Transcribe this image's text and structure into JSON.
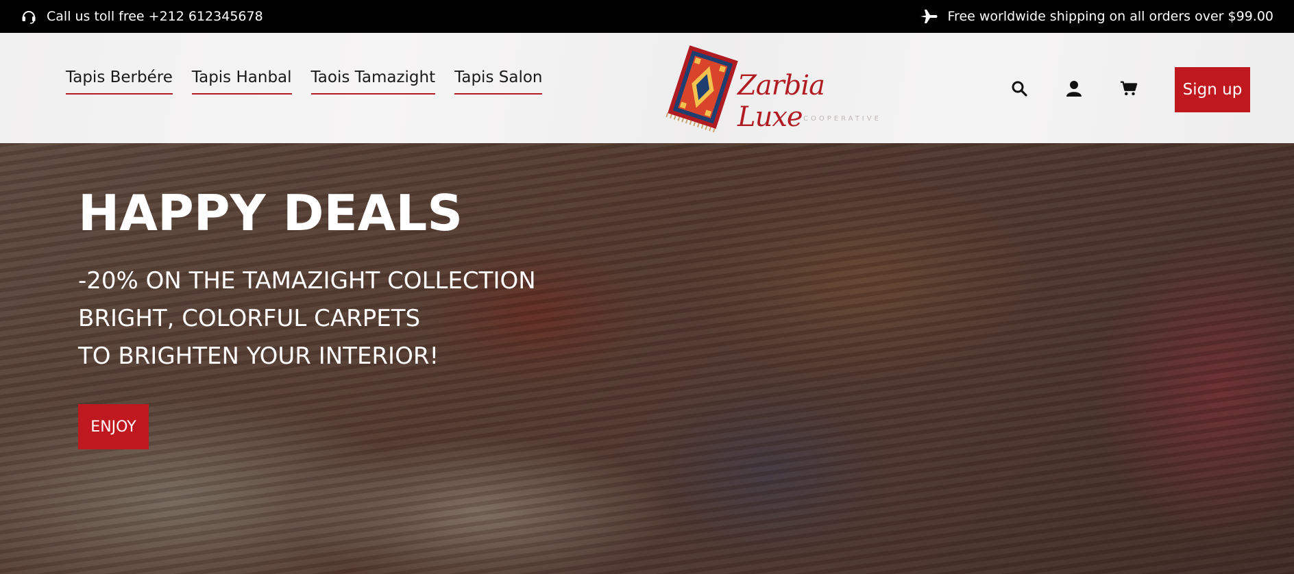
{
  "topbar": {
    "phone_icon": "headset-icon",
    "phone_text": "Call us toll free +212 612345678",
    "shipping_icon": "airplane-icon",
    "shipping_text": "Free worldwide shipping on all orders over $99.00"
  },
  "nav": {
    "items": [
      {
        "label": "Tapis Berbére"
      },
      {
        "label": "Tapis Hanbal"
      },
      {
        "label": "Taois Tamazight"
      },
      {
        "label": "Tapis Salon"
      }
    ]
  },
  "logo": {
    "brand": "Zarbia Luxe",
    "subtitle": "COOPERATIVE"
  },
  "header_icons": {
    "search": "search-icon",
    "account": "user-icon",
    "cart": "cart-icon"
  },
  "signup_label": "Sign up",
  "hero": {
    "title": "HAPPY DEALS",
    "lines": [
      "-20% ON THE TAMAZIGHT COLLECTION",
      "BRIGHT, COLORFUL CARPETS",
      "TO BRIGHTEN YOUR INTERIOR!"
    ],
    "cta_label": "ENJOY"
  },
  "colors": {
    "accent": "#c0181f",
    "topbar_bg": "#000000",
    "header_bg": "#f2f1f1"
  }
}
